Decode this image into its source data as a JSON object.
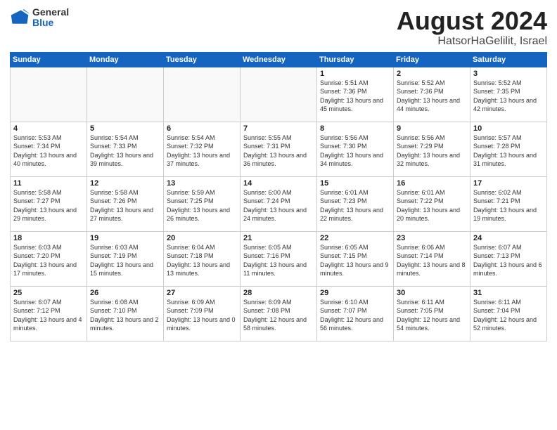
{
  "logo": {
    "line1": "General",
    "line2": "Blue"
  },
  "title": "August 2024",
  "subtitle": "HatsorHaGelilit, Israel",
  "weekdays": [
    "Sunday",
    "Monday",
    "Tuesday",
    "Wednesday",
    "Thursday",
    "Friday",
    "Saturday"
  ],
  "weeks": [
    [
      {
        "day": "",
        "info": ""
      },
      {
        "day": "",
        "info": ""
      },
      {
        "day": "",
        "info": ""
      },
      {
        "day": "",
        "info": ""
      },
      {
        "day": "1",
        "sunrise": "5:51 AM",
        "sunset": "7:36 PM",
        "daylight": "13 hours and 45 minutes."
      },
      {
        "day": "2",
        "sunrise": "5:52 AM",
        "sunset": "7:36 PM",
        "daylight": "13 hours and 44 minutes."
      },
      {
        "day": "3",
        "sunrise": "5:52 AM",
        "sunset": "7:35 PM",
        "daylight": "13 hours and 42 minutes."
      }
    ],
    [
      {
        "day": "4",
        "sunrise": "5:53 AM",
        "sunset": "7:34 PM",
        "daylight": "13 hours and 40 minutes."
      },
      {
        "day": "5",
        "sunrise": "5:54 AM",
        "sunset": "7:33 PM",
        "daylight": "13 hours and 39 minutes."
      },
      {
        "day": "6",
        "sunrise": "5:54 AM",
        "sunset": "7:32 PM",
        "daylight": "13 hours and 37 minutes."
      },
      {
        "day": "7",
        "sunrise": "5:55 AM",
        "sunset": "7:31 PM",
        "daylight": "13 hours and 36 minutes."
      },
      {
        "day": "8",
        "sunrise": "5:56 AM",
        "sunset": "7:30 PM",
        "daylight": "13 hours and 34 minutes."
      },
      {
        "day": "9",
        "sunrise": "5:56 AM",
        "sunset": "7:29 PM",
        "daylight": "13 hours and 32 minutes."
      },
      {
        "day": "10",
        "sunrise": "5:57 AM",
        "sunset": "7:28 PM",
        "daylight": "13 hours and 31 minutes."
      }
    ],
    [
      {
        "day": "11",
        "sunrise": "5:58 AM",
        "sunset": "7:27 PM",
        "daylight": "13 hours and 29 minutes."
      },
      {
        "day": "12",
        "sunrise": "5:58 AM",
        "sunset": "7:26 PM",
        "daylight": "13 hours and 27 minutes."
      },
      {
        "day": "13",
        "sunrise": "5:59 AM",
        "sunset": "7:25 PM",
        "daylight": "13 hours and 26 minutes."
      },
      {
        "day": "14",
        "sunrise": "6:00 AM",
        "sunset": "7:24 PM",
        "daylight": "13 hours and 24 minutes."
      },
      {
        "day": "15",
        "sunrise": "6:01 AM",
        "sunset": "7:23 PM",
        "daylight": "13 hours and 22 minutes."
      },
      {
        "day": "16",
        "sunrise": "6:01 AM",
        "sunset": "7:22 PM",
        "daylight": "13 hours and 20 minutes."
      },
      {
        "day": "17",
        "sunrise": "6:02 AM",
        "sunset": "7:21 PM",
        "daylight": "13 hours and 19 minutes."
      }
    ],
    [
      {
        "day": "18",
        "sunrise": "6:03 AM",
        "sunset": "7:20 PM",
        "daylight": "13 hours and 17 minutes."
      },
      {
        "day": "19",
        "sunrise": "6:03 AM",
        "sunset": "7:19 PM",
        "daylight": "13 hours and 15 minutes."
      },
      {
        "day": "20",
        "sunrise": "6:04 AM",
        "sunset": "7:18 PM",
        "daylight": "13 hours and 13 minutes."
      },
      {
        "day": "21",
        "sunrise": "6:05 AM",
        "sunset": "7:16 PM",
        "daylight": "13 hours and 11 minutes."
      },
      {
        "day": "22",
        "sunrise": "6:05 AM",
        "sunset": "7:15 PM",
        "daylight": "13 hours and 9 minutes."
      },
      {
        "day": "23",
        "sunrise": "6:06 AM",
        "sunset": "7:14 PM",
        "daylight": "13 hours and 8 minutes."
      },
      {
        "day": "24",
        "sunrise": "6:07 AM",
        "sunset": "7:13 PM",
        "daylight": "13 hours and 6 minutes."
      }
    ],
    [
      {
        "day": "25",
        "sunrise": "6:07 AM",
        "sunset": "7:12 PM",
        "daylight": "13 hours and 4 minutes."
      },
      {
        "day": "26",
        "sunrise": "6:08 AM",
        "sunset": "7:10 PM",
        "daylight": "13 hours and 2 minutes."
      },
      {
        "day": "27",
        "sunrise": "6:09 AM",
        "sunset": "7:09 PM",
        "daylight": "13 hours and 0 minutes."
      },
      {
        "day": "28",
        "sunrise": "6:09 AM",
        "sunset": "7:08 PM",
        "daylight": "12 hours and 58 minutes."
      },
      {
        "day": "29",
        "sunrise": "6:10 AM",
        "sunset": "7:07 PM",
        "daylight": "12 hours and 56 minutes."
      },
      {
        "day": "30",
        "sunrise": "6:11 AM",
        "sunset": "7:05 PM",
        "daylight": "12 hours and 54 minutes."
      },
      {
        "day": "31",
        "sunrise": "6:11 AM",
        "sunset": "7:04 PM",
        "daylight": "12 hours and 52 minutes."
      }
    ]
  ],
  "labels": {
    "sunrise": "Sunrise:",
    "sunset": "Sunset:",
    "daylight": "Daylight:"
  },
  "colors": {
    "header_bg": "#1565c0",
    "header_text": "#ffffff",
    "border": "#cccccc",
    "empty_bg": "#f9f9f9"
  }
}
